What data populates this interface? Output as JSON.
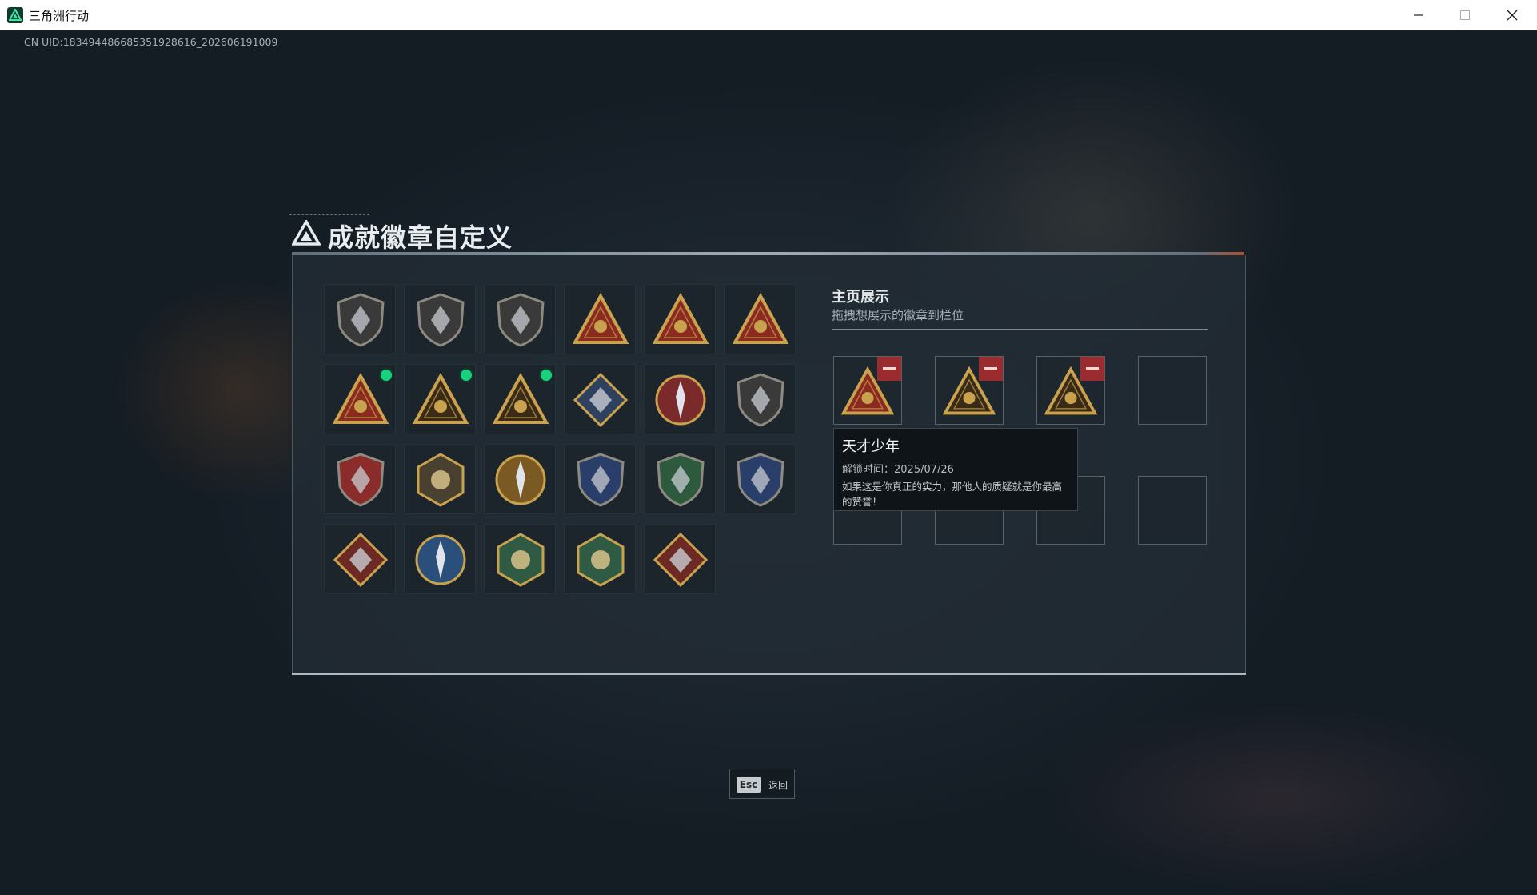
{
  "window": {
    "title": "三角洲行动"
  },
  "uid": "CN UID:18349448668535192861​6_202606191009",
  "header": {
    "title": "成就徽章自定义"
  },
  "badges": [
    {
      "icon": "shield-delta-icon",
      "new": false
    },
    {
      "icon": "helicopter-badge-icon",
      "new": false
    },
    {
      "icon": "dagger-shield-icon",
      "new": false
    },
    {
      "icon": "sb-triangle-badge-icon",
      "new": false
    },
    {
      "icon": "s59-triangle-badge-icon",
      "new": false
    },
    {
      "icon": "number-one-triangle-icon",
      "new": false
    },
    {
      "icon": "operator-triangle-badge-icon",
      "new": true
    },
    {
      "icon": "mask-triangle-badge-icon",
      "new": true
    },
    {
      "icon": "beast-triangle-badge-icon",
      "new": true
    },
    {
      "icon": "diamond-gem-badge-icon",
      "new": false
    },
    {
      "icon": "star-compass-medal-icon",
      "new": false
    },
    {
      "icon": "dark-shield-emblem-icon",
      "new": false
    },
    {
      "icon": "stars-ribbon-shield-icon",
      "new": false
    },
    {
      "icon": "hex-gem-shield-icon",
      "new": false
    },
    {
      "icon": "gold-lion-medal-icon",
      "new": false
    },
    {
      "icon": "blue-crossed-rifles-shield-icon",
      "new": false
    },
    {
      "icon": "green-crosshair-shield-icon",
      "new": false
    },
    {
      "icon": "blue-gold-rifles-shield-icon",
      "new": false
    },
    {
      "icon": "wolf-diamond-badge-icon",
      "new": false
    },
    {
      "icon": "blue-arrow-circle-badge-icon",
      "new": false
    },
    {
      "icon": "green-insect-hex-badge-icon",
      "new": false
    },
    {
      "icon": "green-brute-hex-badge-icon",
      "new": false
    },
    {
      "icon": "dragon-diamond-badge-icon",
      "new": false
    }
  ],
  "showcase": {
    "title": "主页展示",
    "subtitle": "拖拽想展示的徽章到栏位",
    "slots": [
      {
        "icon": "operator-triangle-badge-icon",
        "filled": true
      },
      {
        "icon": "mask-triangle-badge-icon",
        "filled": true
      },
      {
        "icon": "beast-triangle-badge-icon",
        "filled": true
      },
      {
        "icon": "",
        "filled": false
      },
      {
        "icon": "",
        "filled": false
      },
      {
        "icon": "",
        "filled": false
      },
      {
        "icon": "",
        "filled": false
      },
      {
        "icon": "",
        "filled": false
      }
    ]
  },
  "tooltip": {
    "title": "天才少年",
    "unlock_time": "解锁时间：2025/07/26",
    "description": "如果这是你真正的实力，那他人的质疑就是你最高的赞誉！"
  },
  "footer": {
    "key": "Esc",
    "label": "返回"
  },
  "colors": {
    "new_dot": "#17d17f",
    "remove": "#9a2c2f",
    "gold": "#c9a24d",
    "badge_red": "#8a2a20"
  }
}
